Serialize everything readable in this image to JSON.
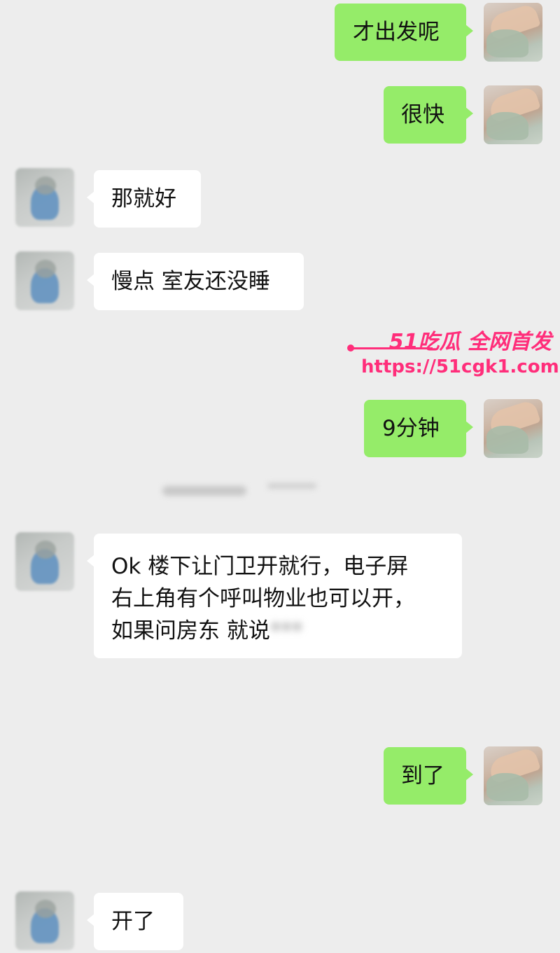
{
  "messages": [
    {
      "side": "self",
      "text": "才出发呢"
    },
    {
      "side": "self",
      "text": "很快"
    },
    {
      "side": "other",
      "text": "那就好"
    },
    {
      "side": "other",
      "text": "慢点 室友还没睡"
    },
    {
      "side": "self",
      "text": "9分钟"
    },
    {
      "side": "other",
      "lines": [
        "Ok  楼下让门卫开就行，电子屏",
        "右上角有个呼叫物业也可以开，",
        "如果问房东 就说"
      ],
      "blurred_tail": "***"
    },
    {
      "side": "self",
      "text": "到了"
    },
    {
      "side": "other",
      "text": "开了"
    }
  ],
  "watermark": {
    "brand": "51吃瓜 全网首发",
    "url": "https://51cgk1.com"
  },
  "colors": {
    "background": "#ededed",
    "self_bubble": "#95ec69",
    "other_bubble": "#ffffff",
    "watermark": "#ff2d7a"
  }
}
